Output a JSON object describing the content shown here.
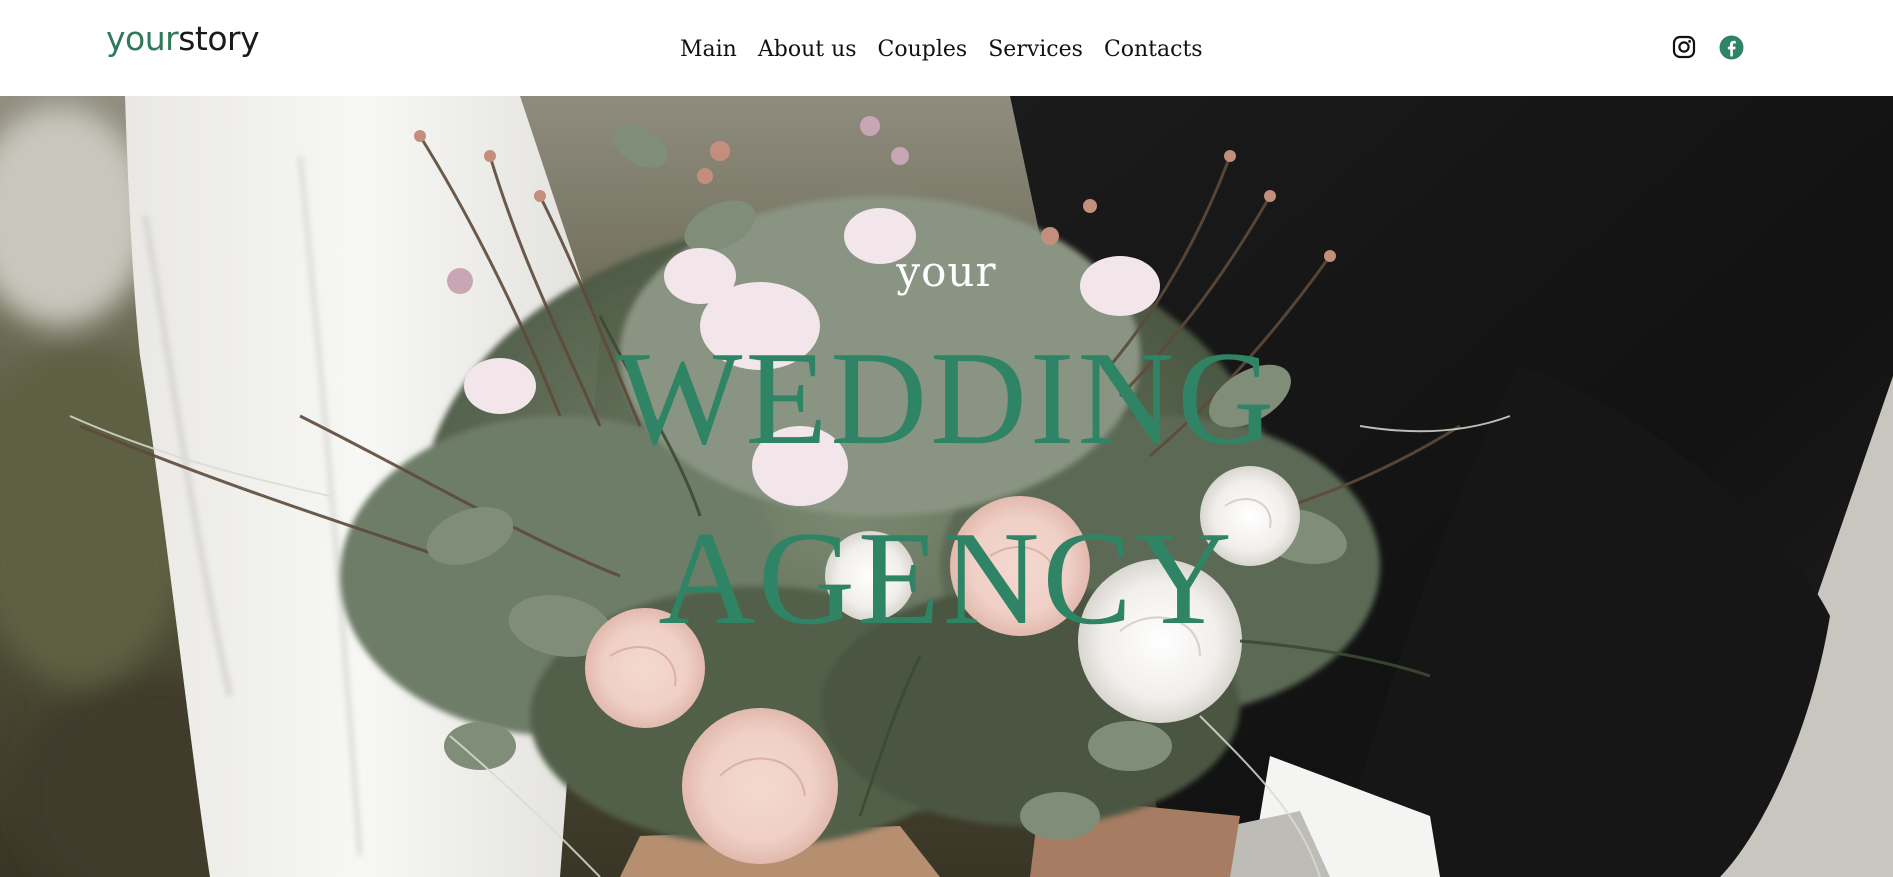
{
  "brand": {
    "logo_part_1": "your",
    "logo_part_2": "story"
  },
  "nav": {
    "items": [
      "Main",
      "About us",
      "Couples",
      "Services",
      "Contacts"
    ]
  },
  "social": {
    "icons": [
      "instagram-icon",
      "facebook-icon"
    ]
  },
  "hero": {
    "kicker": "your",
    "line1": "WEDDING",
    "line2": "AGENCY"
  },
  "colors": {
    "accent_green": "#2e8465",
    "logo_green": "#2f7a5c",
    "text_dark": "#111111",
    "header_bg": "#ffffff"
  }
}
